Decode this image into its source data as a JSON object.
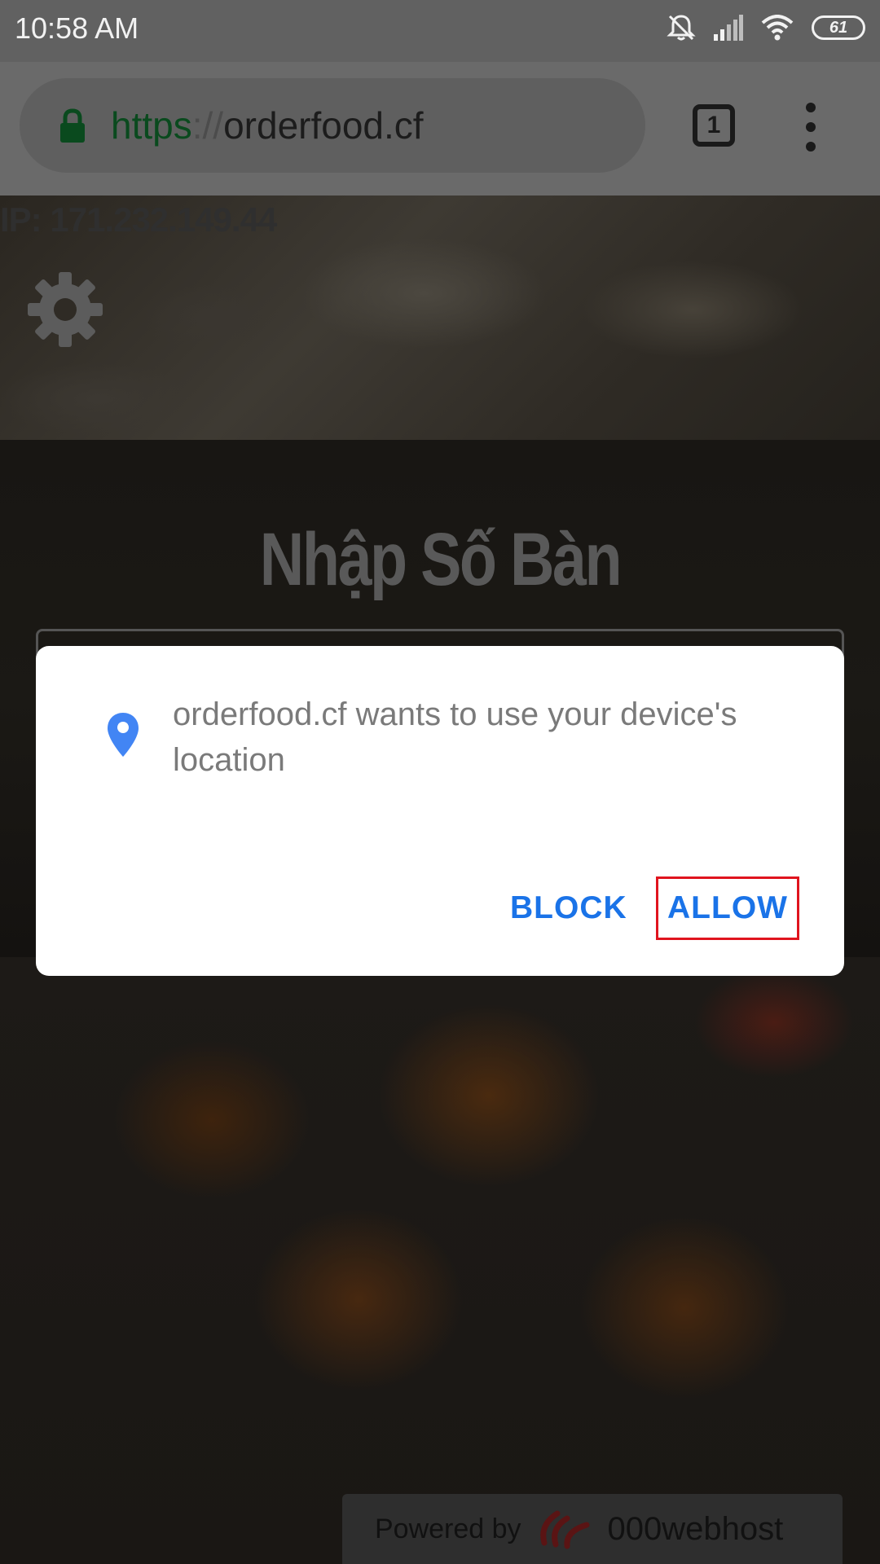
{
  "status_bar": {
    "time": "10:58  AM",
    "battery": "61",
    "icons": [
      "mute-icon",
      "signal-icon",
      "wifi-icon",
      "battery-icon"
    ]
  },
  "browser": {
    "url_scheme": "https",
    "url_separator": "://",
    "url_host": "orderfood.cf",
    "tab_count": "1"
  },
  "page": {
    "ip_text": "IP: 171.232.149.44",
    "heading": "Nhập Số Bàn",
    "powered_by": "Powered by",
    "host_brand": "000webhost"
  },
  "dialog": {
    "message": "orderfood.cf wants to use your device's location",
    "block_label": "BLOCK",
    "allow_label": "ALLOW"
  },
  "colors": {
    "accent": "#1a73e8",
    "highlight_border": "#e0141e",
    "pin": "#4285f4"
  }
}
